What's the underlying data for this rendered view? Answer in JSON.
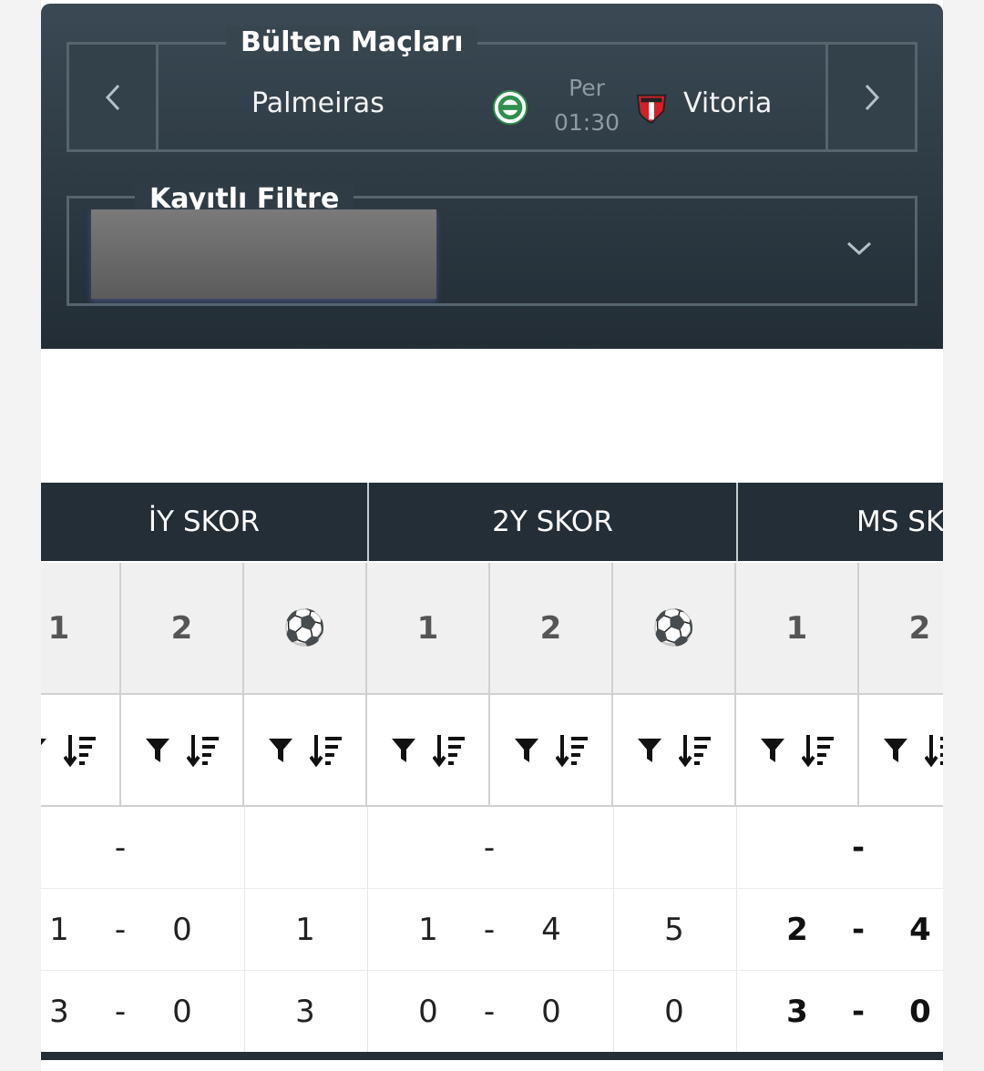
{
  "match_selector": {
    "legend": "Bülten Maçları",
    "home_team": "Palmeiras",
    "away_team": "Vitoria",
    "day": "Per",
    "time": "01:30"
  },
  "saved_filter": {
    "legend": "Kayıtlı Filtre"
  },
  "table": {
    "groups": [
      "İY SKOR",
      "2Y SKOR",
      "MS SKOR"
    ],
    "column_headers": [
      "1",
      "2",
      "⚽",
      "1",
      "2",
      "⚽",
      "1",
      "2"
    ],
    "rows": [
      {
        "iy_sep": "-",
        "y2_sep": "-",
        "ms_sep": "-"
      },
      {
        "iy_1": "1",
        "iy_sep": "-",
        "iy_2": "0",
        "iy_total": "1",
        "y2_1": "1",
        "y2_sep": "-",
        "y2_2": "4",
        "y2_total": "5",
        "ms_1": "2",
        "ms_sep": "-",
        "ms_2": "4"
      },
      {
        "iy_1": "3",
        "iy_sep": "-",
        "iy_2": "0",
        "iy_total": "3",
        "y2_1": "0",
        "y2_sep": "-",
        "y2_2": "0",
        "y2_total": "0",
        "ms_1": "3",
        "ms_sep": "-",
        "ms_2": "0"
      }
    ]
  },
  "colors": {
    "header_dark": "#232e37",
    "panel_top": "#3a4954",
    "panel_bottom": "#222d35",
    "palmeiras_green": "#2f8f4e",
    "vitoria_red": "#d0202a"
  }
}
